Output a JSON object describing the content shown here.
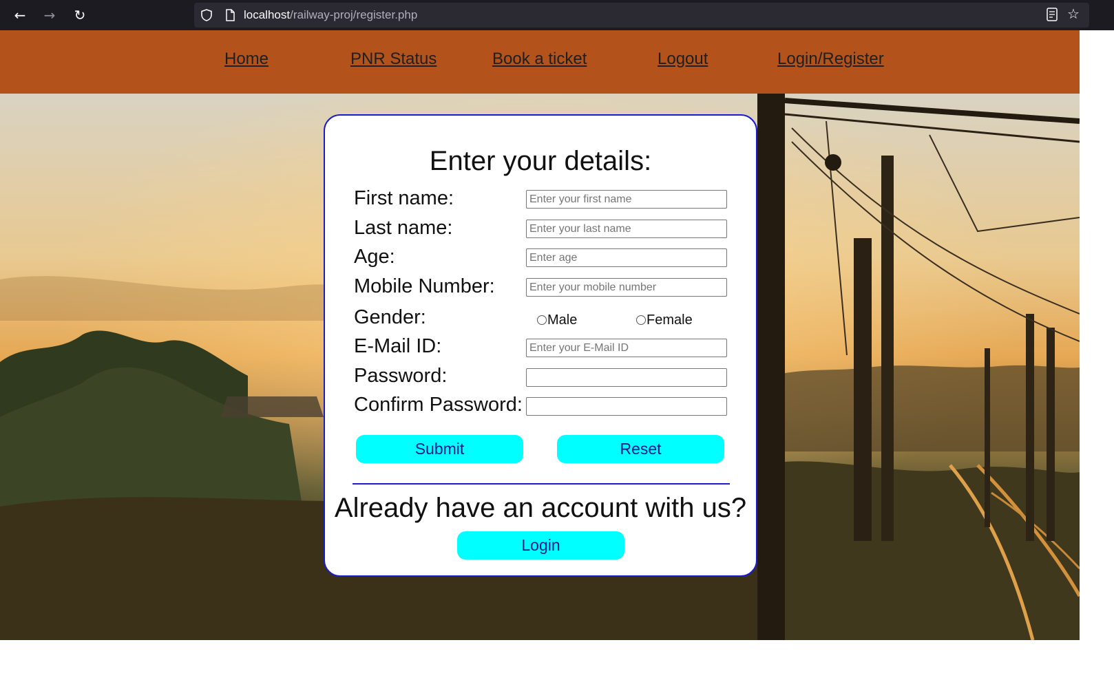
{
  "browser": {
    "url_host": "localhost",
    "url_path": "/railway-proj/register.php",
    "icons": [
      "back-arrow-icon",
      "forward-arrow-icon",
      "reload-icon",
      "shield-icon",
      "page-icon",
      "reader-view-icon",
      "bookmark-star-icon"
    ]
  },
  "nav": {
    "home": "Home",
    "pnr": "PNR Status",
    "book": "Book a ticket",
    "logout": "Logout",
    "login_register": "Login/Register"
  },
  "form": {
    "title": "Enter your details:",
    "first_name": {
      "label": "First name:",
      "placeholder": "Enter your first name",
      "value": ""
    },
    "last_name": {
      "label": "Last name:",
      "placeholder": "Enter your last name",
      "value": ""
    },
    "age": {
      "label": "Age:",
      "placeholder": "Enter age",
      "value": ""
    },
    "mobile": {
      "label": "Mobile Number:",
      "placeholder": "Enter your mobile number",
      "value": ""
    },
    "gender": {
      "label": "Gender:",
      "options": [
        "Male",
        "Female"
      ],
      "selected": null
    },
    "email": {
      "label": "E-Mail ID:",
      "placeholder": "Enter your E-Mail ID",
      "value": ""
    },
    "password": {
      "label": "Password:",
      "value": ""
    },
    "confirm_password": {
      "label": "Confirm Password:",
      "value": ""
    },
    "submit_label": "Submit",
    "reset_label": "Reset",
    "already_text": "Already have an account with us?",
    "login_label": "Login"
  },
  "colors": {
    "header_bg": "#b4521b",
    "button_bg": "#00ffff",
    "card_border": "#1a1acf",
    "browser_chrome": "#1c1b22"
  }
}
